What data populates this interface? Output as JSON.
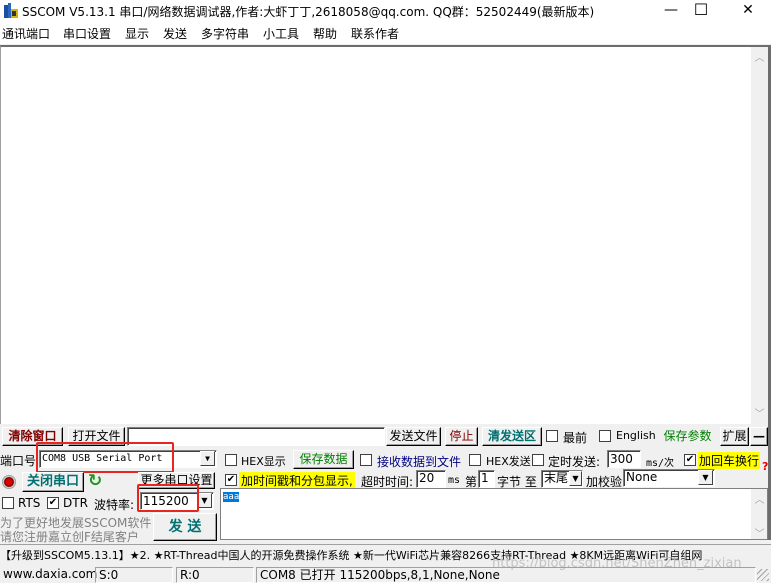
{
  "window": {
    "title": "SSCOM V5.13.1 串口/网络数据调试器,作者:大虾丁丁,2618058@qq.com. QQ群：52502449(最新版本)",
    "minimize_glyph": "—",
    "maximize_glyph": "☐",
    "close_glyph": "✕"
  },
  "menu": [
    "通讯端口",
    "串口设置",
    "显示",
    "发送",
    "多字符串",
    "小工具",
    "帮助",
    "联系作者"
  ],
  "receive": {
    "content": "",
    "scroll_up": "︿",
    "scroll_down": "﹀"
  },
  "toolbar1": {
    "clear_window": "清除窗口",
    "open_file": "打开文件",
    "file_path": "",
    "send_file": "发送文件",
    "stop": "停止",
    "clear_send": "清发送区",
    "topmost_label": "最前",
    "topmost_checked": false,
    "english_label": "English",
    "english_checked": false,
    "save_params": "保存参数",
    "expand": "扩展",
    "collapse": "—"
  },
  "port": {
    "label": "端口号",
    "value": "COM8 USB Serial Port",
    "close_port": "关闭串口",
    "more_settings": "更多串口设置",
    "rts_label": "RTS",
    "rts_checked": false,
    "dtr_label": "DTR",
    "dtr_checked": true,
    "baud_label": "波特率:",
    "baud_value": "115200",
    "promo_line1": "为了更好地发展SSCOM软件",
    "promo_line2": "请您注册嘉立创F结尾客户",
    "send_button": "发  送"
  },
  "options": {
    "hex_display_label": "HEX显示",
    "hex_display_checked": false,
    "save_data": "保存数据",
    "recv_to_file_label": "接收数据到文件",
    "recv_to_file_checked": false,
    "hex_send_label": "HEX发送",
    "hex_send_checked": false,
    "timed_send_label": "定时发送:",
    "timed_send_checked": false,
    "interval_value": "300",
    "interval_unit": "ms/次",
    "add_crlf_label": "加回车换行",
    "add_crlf_checked": true,
    "help_glyph": "?",
    "timestamp_label": "加时间戳和分包显示,",
    "timestamp_checked": true,
    "timeout_label": "超时时间:",
    "timeout_value": "20",
    "timeout_unit": "ms",
    "byte_from_label": "第",
    "byte_from_value": "1",
    "byte_unit_label": "字节 至",
    "byte_to_value": "末尾",
    "checksum_label": "加校验",
    "checksum_value": "None"
  },
  "send": {
    "content": "aaa"
  },
  "ticker": "【升级到SSCOM5.13.1】★2. ★RT-Thread中国人的开源免费操作系统 ★新一代WiFi芯片兼容8266支持RT-Thread ★8KM远距离WiFi可自组网",
  "watermark": "https://blog.csdn.net/ShenZhen_zixian",
  "status": {
    "website": "www.daxia.com",
    "sent": "S:0",
    "received": "R:0",
    "port_status": "COM8 已打开  115200bps,8,1,None,None"
  },
  "colors": {
    "highlight_yellow": "#ffff00",
    "green_text": "#008000",
    "teal_text": "#007070",
    "dark_red_text": "#800000",
    "annotation_red": "#e8261f",
    "selection_blue": "#0078d7"
  }
}
